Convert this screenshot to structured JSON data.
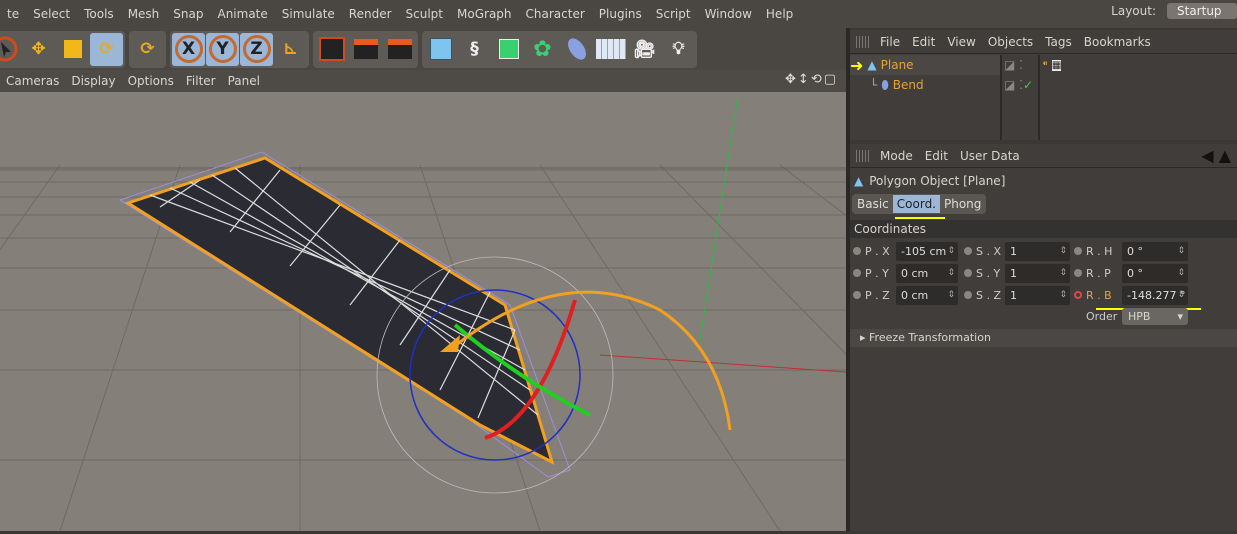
{
  "menu": [
    "te",
    "Select",
    "Tools",
    "Mesh",
    "Snap",
    "Animate",
    "Simulate",
    "Render",
    "Sculpt",
    "MoGraph",
    "Character",
    "Plugins",
    "Script",
    "Window",
    "Help"
  ],
  "layout": {
    "label": "Layout:",
    "value": "Startup"
  },
  "toolbar": {
    "x": "X",
    "y": "Y",
    "z": "Z"
  },
  "viewport_menu": [
    "Cameras",
    "Display",
    "Options",
    "Filter",
    "Panel"
  ],
  "object_manager": {
    "menu": [
      "File",
      "Edit",
      "View",
      "Objects",
      "Tags",
      "Bookmarks"
    ],
    "objects": [
      {
        "name": "Plane"
      },
      {
        "name": "Bend"
      }
    ]
  },
  "attributes": {
    "menu": [
      "Mode",
      "Edit",
      "User Data"
    ],
    "title": "Polygon Object [Plane]",
    "tabs": [
      "Basic",
      "Coord.",
      "Phong"
    ],
    "section": "Coordinates",
    "rows": [
      {
        "p_label": "P . X",
        "p": "-105 cm",
        "s_label": "S . X",
        "s": "1",
        "r_label": "R . H",
        "r": "0 °"
      },
      {
        "p_label": "P . Y",
        "p": "0 cm",
        "s_label": "S . Y",
        "s": "1",
        "r_label": "R . P",
        "r": "0 °"
      },
      {
        "p_label": "P . Z",
        "p": "0 cm",
        "s_label": "S . Z",
        "s": "1",
        "r_label": "R . B",
        "r": "-148.277 °"
      }
    ],
    "order_label": "Order",
    "order": "HPB",
    "freeze": "Freeze Transformation"
  },
  "colors": {
    "accent": "#9cb6d8",
    "object": "#e8a23a",
    "highlight": "#ffff00"
  }
}
